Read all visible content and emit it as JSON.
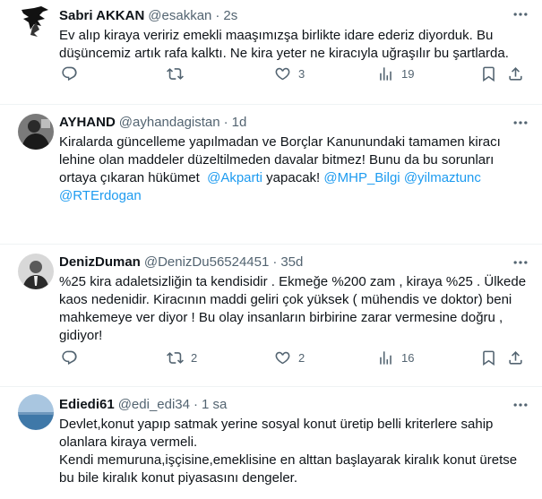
{
  "tweets": [
    {
      "name": "Sabri AKKAN",
      "handle": "@esakkan",
      "time": "2s",
      "text": "Ev alıp kiraya veririz emekli maaşımızşa birlikte idare ederiz diyorduk. Bu düşüncemiz artık rafa kalktı. Ne kira yeter ne kiracıyla uğraşılır bu şartlarda.",
      "reply_count": "",
      "retweet_count": "",
      "like_count": "3",
      "view_count": "19",
      "avatar_icon": "eagle-silhouette"
    },
    {
      "name": "AYHAND",
      "handle": "@ayhandagistan",
      "time": "1d",
      "text_line1": "Kiralarda güncelleme yapılmadan ve Borçlar Kanunundaki tamamen kiracı lehine olan maddeler düzeltilmeden davalar bitmez! Bunu da bu sorunları ortaya çıkaran hükümet  ",
      "mention1": "@Akparti",
      "text_mid": " yapacak! ",
      "mention2": "@MHP_Bilgi",
      "text_sp": " ",
      "mention3": "@yilmaztunc",
      "mention4": "@RTErdogan",
      "avatar_icon": "person-photo"
    },
    {
      "name": "DenizDuman",
      "handle": "@DenizDu56524451",
      "time": "35d",
      "text": "%25 kira adaletsizliğin ta kendisidir . Ekmeğe %200 zam , kiraya %25 . Ülkede kaos nedenidir. Kiracının maddi geliri çok yüksek ( mühendis ve doktor) beni mahkemeye ver diyor ! Bu olay insanların birbirine zarar vermesine doğru , gidiyor!",
      "reply_count": "",
      "retweet_count": "2",
      "like_count": "2",
      "view_count": "16",
      "avatar_icon": "person-photo"
    },
    {
      "name": "Ediedi61",
      "handle": "@edi_edi34",
      "time": "1 sa",
      "text": "Devlet,konut yapıp satmak yerine sosyal konut üretip belli kriterlere sahip olanlara kiraya vermeli.\nKendi memuruna,işçisine,emeklisine en alttan başlayarak kiralık konut üretse bu bile kiralık konut piyasasını dengeler.",
      "avatar_icon": "sea-landscape"
    }
  ],
  "separator": "·",
  "colors": {
    "accent": "#1d9bf0",
    "muted": "#536471",
    "text": "#0f1419",
    "border": "#eff3f4"
  }
}
